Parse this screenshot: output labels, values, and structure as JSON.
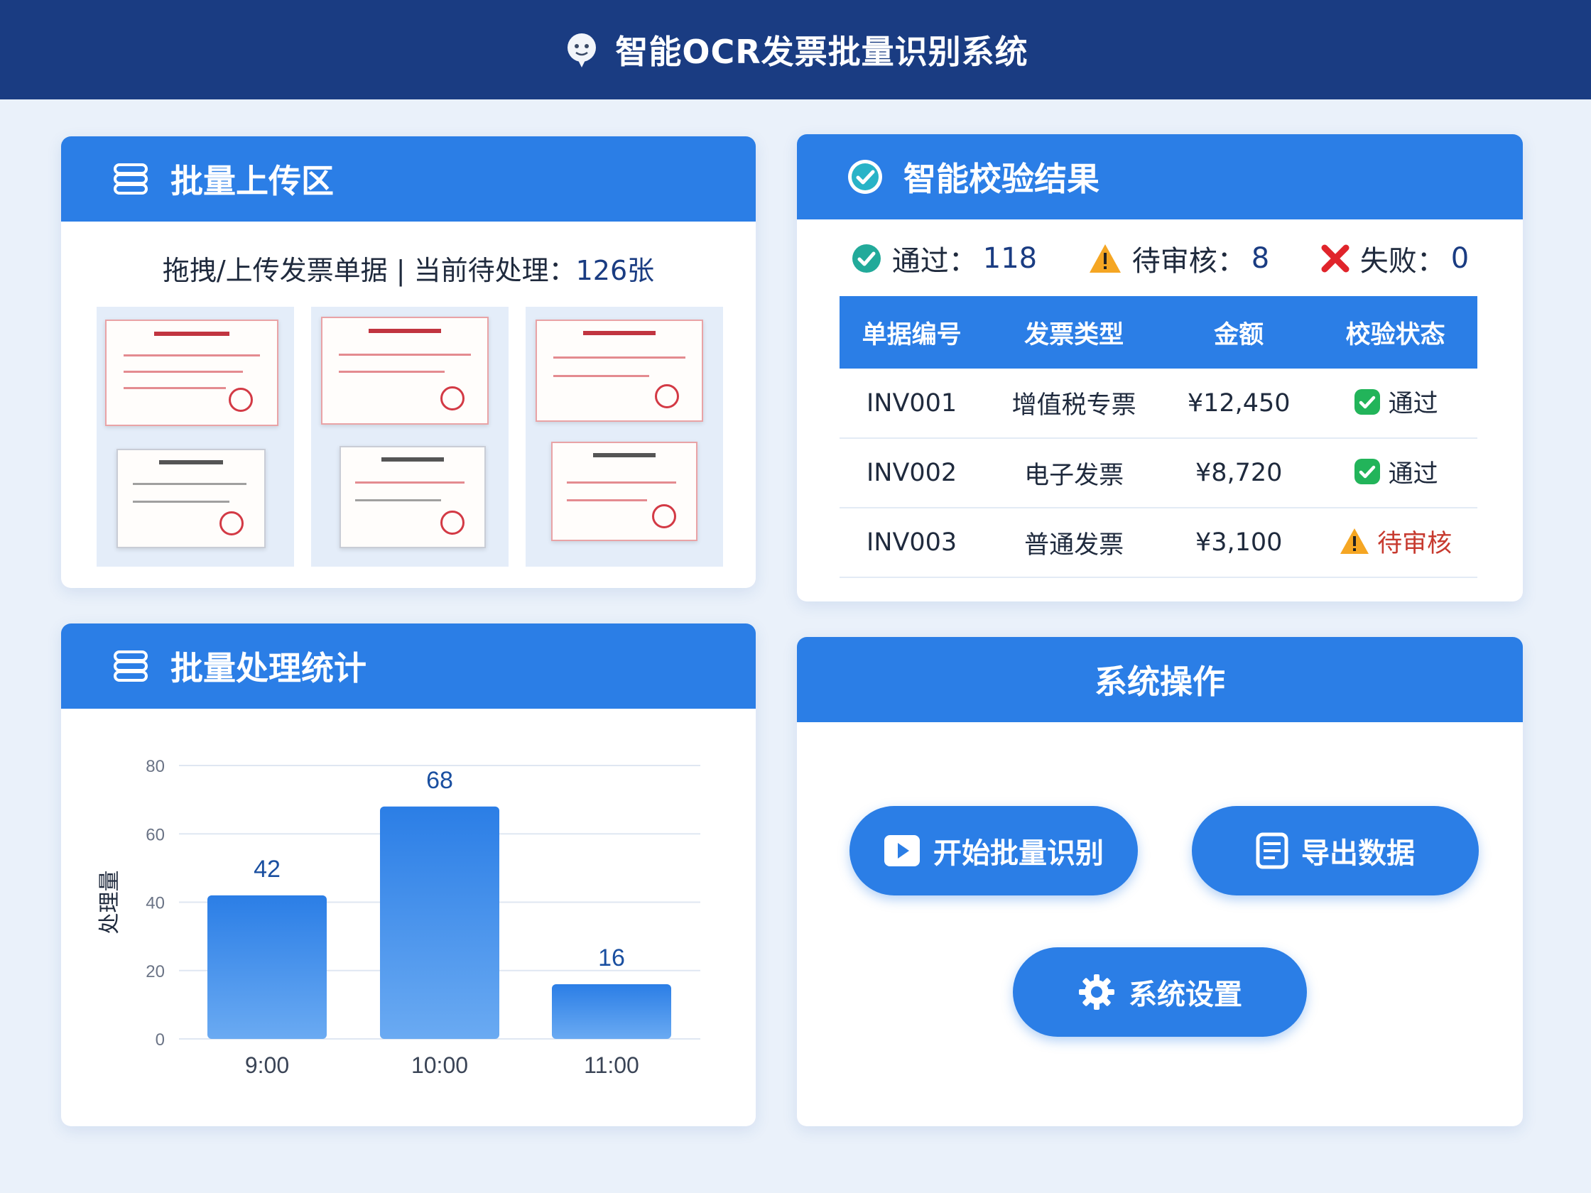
{
  "app": {
    "title": "智能OCR发票批量识别系统"
  },
  "upload": {
    "title": "批量上传区",
    "info_prefix": "拖拽/上传发票单据 | 当前待处理：",
    "pending_count": "126张"
  },
  "verify": {
    "title": "智能校验结果",
    "summary": [
      {
        "label": "通过：",
        "value": "118",
        "icon": "check-circle-icon"
      },
      {
        "label": "待审核：",
        "value": "8",
        "icon": "warning-icon"
      },
      {
        "label": "失败：",
        "value": "0",
        "icon": "cross-icon"
      }
    ],
    "columns": [
      "单据编号",
      "发票类型",
      "金额",
      "校验状态"
    ],
    "rows": [
      {
        "id": "INV001",
        "type": "增值税专票",
        "amount": "¥12,450",
        "status": "通过"
      },
      {
        "id": "INV002",
        "type": "电子发票",
        "amount": "¥8,720",
        "status": "通过"
      },
      {
        "id": "INV003",
        "type": "普通发票",
        "amount": "¥3,100",
        "status": "待审核"
      }
    ]
  },
  "stats": {
    "title": "批量处理统计"
  },
  "actions": {
    "title": "系统操作",
    "start_label": "开始批量识别",
    "export_label": "导出数据",
    "settings_label": "系统设置"
  },
  "colors": {
    "header": "#1a3c82",
    "accent": "#2b7ee6",
    "pass": "#22b45a",
    "warn": "#f5a623",
    "fail": "#e0242b"
  },
  "chart_data": {
    "type": "bar",
    "categories": [
      "9:00",
      "10:00",
      "11:00"
    ],
    "values": [
      42,
      68,
      16
    ],
    "ylabel": "处理量",
    "xlabel": "",
    "ylim": [
      0,
      80
    ],
    "yticks": [
      0,
      20,
      40,
      60,
      80
    ],
    "grid": true
  }
}
